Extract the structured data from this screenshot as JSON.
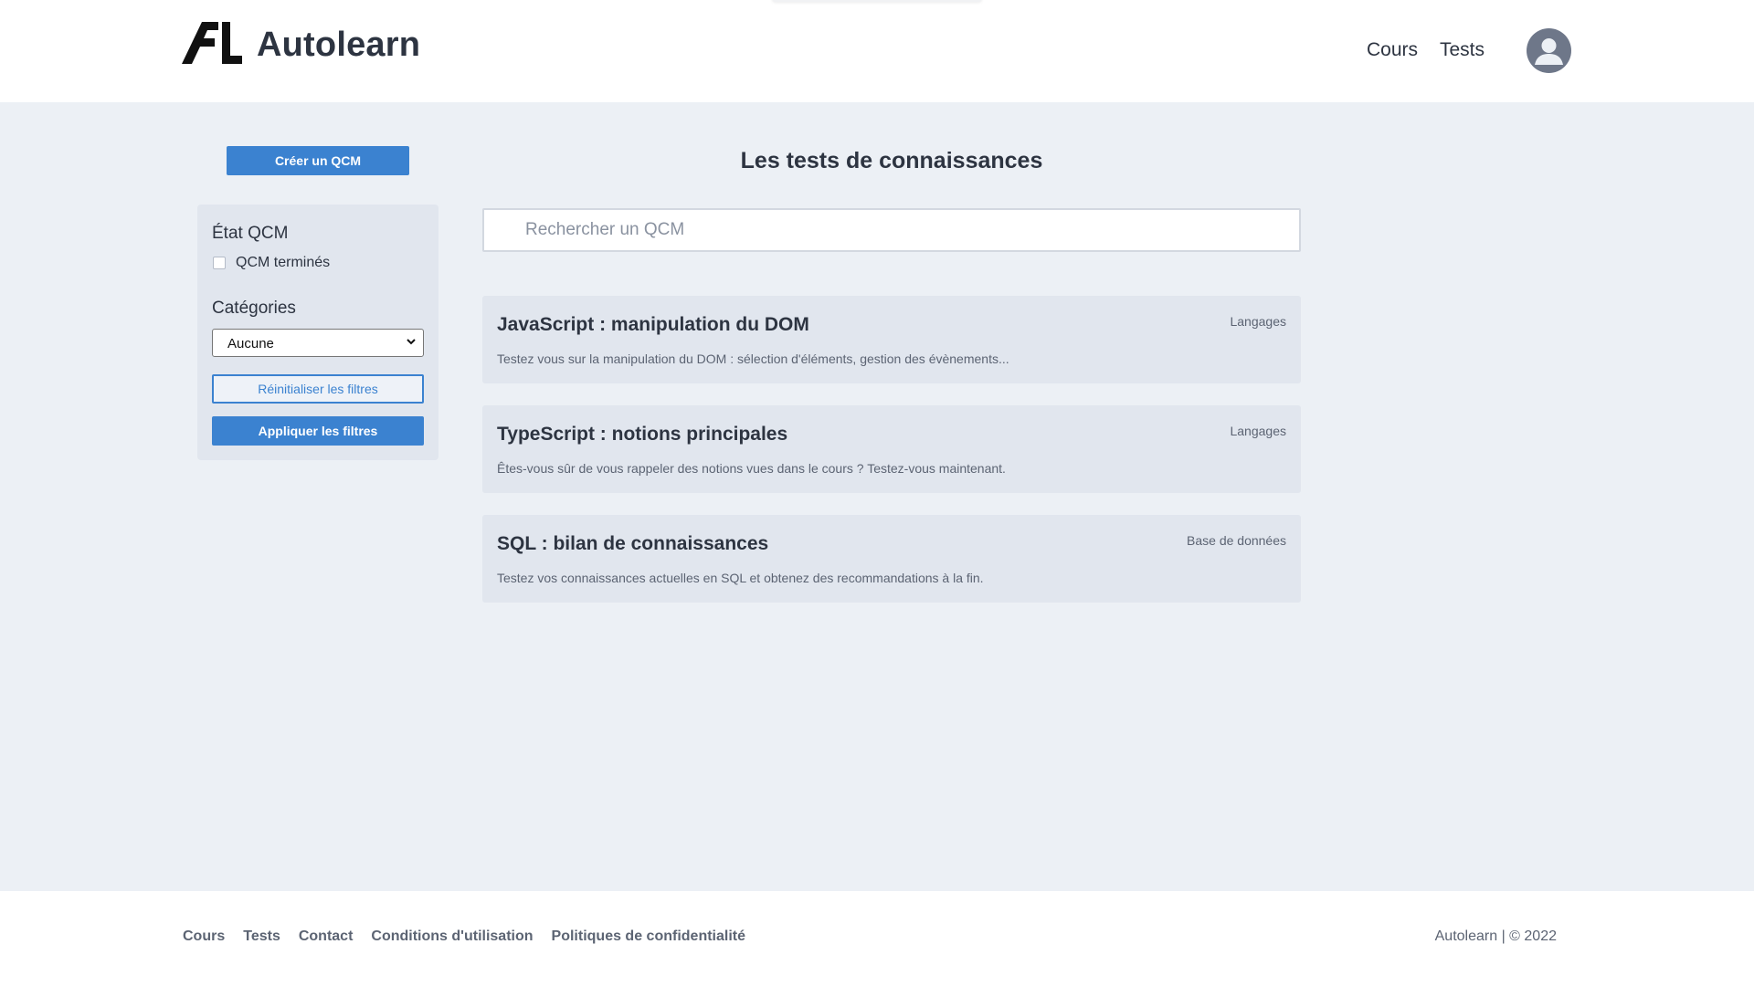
{
  "header": {
    "brand": "Autolearn",
    "nav": [
      {
        "label": "Cours"
      },
      {
        "label": "Tests"
      }
    ],
    "avatar_icon": "user-icon"
  },
  "sidebar": {
    "create_button": "Créer un QCM",
    "state_title": "État QCM",
    "checkbox_label": "QCM terminés",
    "checkbox_checked": false,
    "categories_title": "Catégories",
    "category_selected": "Aucune",
    "reset_button": "Réinitialiser les filtres",
    "apply_button": "Appliquer les filtres"
  },
  "main": {
    "title": "Les tests de connaissances",
    "search_placeholder": "Rechercher un QCM",
    "cards": [
      {
        "title": "JavaScript : manipulation du DOM",
        "description": "Testez vous sur la manipulation du DOM : sélection d'éléments, gestion des évènements...",
        "category": "Langages"
      },
      {
        "title": "TypeScript : notions principales",
        "description": "Êtes-vous sûr de vous rappeler des notions vues dans le cours ? Testez-vous maintenant.",
        "category": "Langages"
      },
      {
        "title": "SQL : bilan de connaissances",
        "description": "Testez vos connaissances actuelles en SQL et obtenez des recommandations à la fin.",
        "category": "Base de données"
      }
    ]
  },
  "footer": {
    "links": [
      {
        "label": "Cours"
      },
      {
        "label": "Tests"
      },
      {
        "label": "Contact"
      },
      {
        "label": "Conditions d'utilisation"
      },
      {
        "label": "Politiques de confidentialité"
      }
    ],
    "copyright": "Autolearn | © 2022"
  },
  "colors": {
    "accent": "#3b82d0",
    "background": "#ecf0f5",
    "card": "#e1e6ee",
    "text": "#2d3441"
  }
}
